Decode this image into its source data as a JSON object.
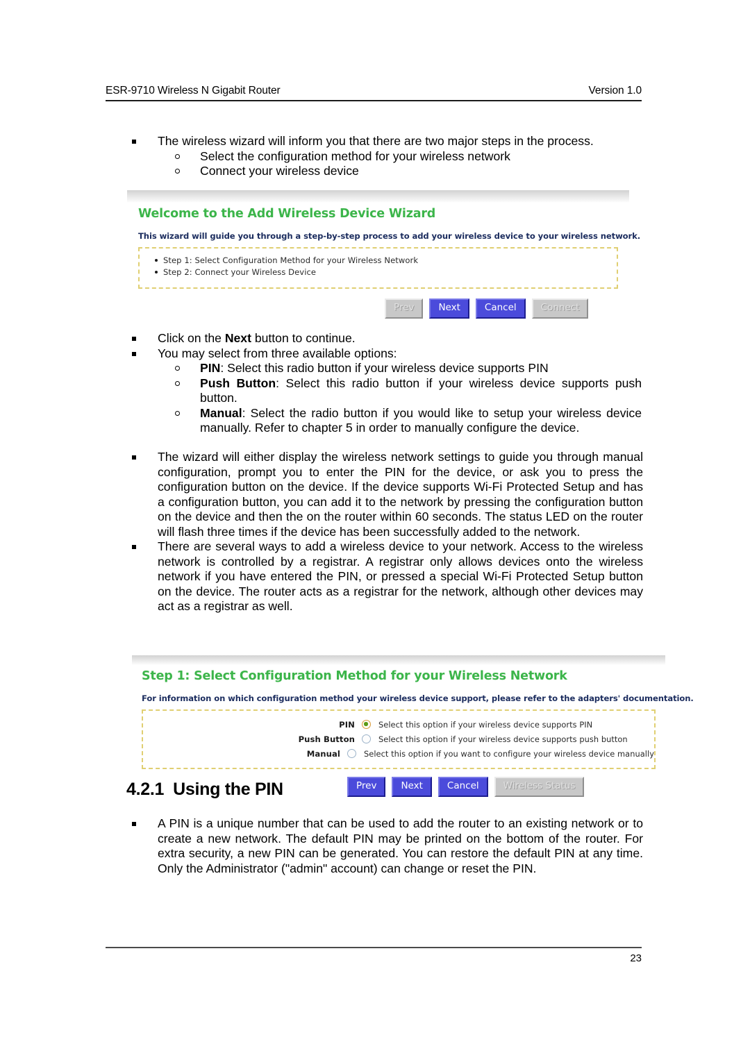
{
  "header": {
    "left": "ESR-9710 Wireless N Gigabit Router",
    "right": "Version 1.0"
  },
  "footer": {
    "page_number": "23"
  },
  "intro": {
    "b1": "The wireless wizard will inform you that there are two major steps in the process.",
    "sub1": "Select the configuration method for your wireless network",
    "sub2": "Connect your wireless device"
  },
  "wizard_welcome": {
    "title": "Welcome to the Add Wireless Device Wizard",
    "subtitle": "This wizard will guide you through a step-by-step process to add your wireless device to your wireless network.",
    "steps": [
      "Step 1: Select Configuration Method for your Wireless Network",
      "Step 2: Connect your Wireless Device"
    ],
    "buttons": [
      {
        "label": "Prev",
        "state": "disabled"
      },
      {
        "label": "Next",
        "state": "primary"
      },
      {
        "label": "Cancel",
        "state": "primary"
      },
      {
        "label": "Connect",
        "state": "disabled"
      }
    ]
  },
  "mid": {
    "click_next_pre": "Click on the ",
    "click_next_bold": "Next",
    "click_next_post": " button to continue.",
    "three_options": "You may select from three available options:",
    "opt_pin_bold": "PIN",
    "opt_pin_rest": ": Select this radio button if your wireless device supports PIN",
    "opt_push_bold": "Push Button",
    "opt_push_rest": ": Select this radio button if your wireless device supports push button.",
    "opt_manual_bold": "Manual",
    "opt_manual_rest": ": Select the radio button if you would like to setup your wireless device manually. Refer to chapter 5 in order to manually configure the device."
  },
  "long": {
    "para1": "The wizard will either display the wireless network settings to guide you through manual configuration, prompt you to enter the PIN for the device, or ask you to press the configuration button on the device. If the device supports Wi-Fi Protected Setup and has a configuration button, you can add it to the network by pressing the configuration button on the device and then the on the router within 60 seconds. The status LED on the router will flash three times if the device has been successfully added to the network.",
    "para2": "There are several ways to add a wireless device to your network. Access to the wireless network is controlled by a registrar. A registrar only allows devices onto the wireless network if you have entered the PIN, or pressed a special Wi-Fi Protected Setup button on the device. The router acts as a registrar for the network, although other devices may act as a registrar as well."
  },
  "wizard_step1": {
    "title": "Step 1: Select Configuration Method for your Wireless Network",
    "subtitle": "For information on which configuration method your wireless device support, please refer to the adapters' documentation.",
    "options": [
      {
        "label": "PIN",
        "text": "Select this option if your wireless device supports PIN",
        "selected": true
      },
      {
        "label": "Push Button",
        "text": "Select this option if your wireless device supports push button",
        "selected": false
      },
      {
        "label": "Manual",
        "text": "Select this option if you want to configure your wireless device manually",
        "selected": false
      }
    ],
    "buttons": [
      {
        "label": "Prev",
        "state": "primary"
      },
      {
        "label": "Next",
        "state": "primary"
      },
      {
        "label": "Cancel",
        "state": "primary"
      },
      {
        "label": "Wireless Status",
        "state": "disabled"
      }
    ]
  },
  "section": {
    "number": "4.2.1",
    "title": "Using the PIN",
    "body": "A PIN is a unique number that can be used to add the router to an existing network or to create a new network. The default PIN may be printed on the bottom of the router. For extra security, a new PIN can be generated. You can restore the default PIN at any time. Only the Administrator (\"admin\" account) can change or reset the PIN."
  },
  "colors": {
    "wizard_title_green": "#3cb54a",
    "wizard_subtitle_navy": "#1b2c5e",
    "dashed_border_yellow": "#e0cf72",
    "button_blue": "#4b4bdb",
    "button_disabled_gray": "#c8c8c8",
    "radio_selected_dot": "#5a9a16"
  }
}
